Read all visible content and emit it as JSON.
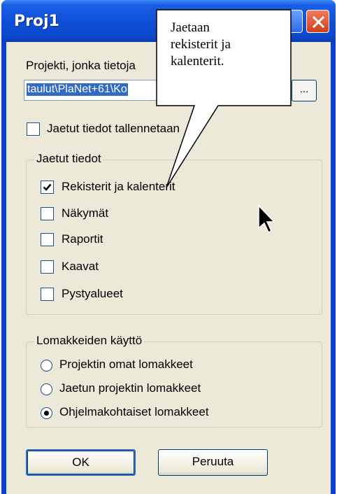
{
  "window": {
    "title": "Proj1"
  },
  "project": {
    "label": "Projekti, jonka tietoja",
    "path_value": "taulut\\PlaNet+61\\Ko",
    "browse_label": "..."
  },
  "save_shared": {
    "label": "Jaetut tiedot tallennetaan",
    "checked": false
  },
  "shared_group": {
    "legend": "Jaetut tiedot",
    "items": [
      {
        "label": "Rekisterit ja kalenterit",
        "checked": true
      },
      {
        "label": "Näkymät",
        "checked": false
      },
      {
        "label": "Raportit",
        "checked": false
      },
      {
        "label": "Kaavat",
        "checked": false
      },
      {
        "label": "Pystyalueet",
        "checked": false
      }
    ]
  },
  "forms_group": {
    "legend": "Lomakkeiden käyttö",
    "options": [
      {
        "label": "Projektin omat lomakkeet",
        "selected": false
      },
      {
        "label": "Jaetun projektin lomakkeet",
        "selected": false
      },
      {
        "label": "Ohjelmakohtaiset lomakkeet",
        "selected": true
      }
    ]
  },
  "buttons": {
    "ok": "OK",
    "cancel": "Peruuta"
  },
  "callout": {
    "line1": "Jaetaan",
    "line2": "rekisterit ja",
    "line3": "kalenterit."
  },
  "colors": {
    "titlebar": "#0c47cc",
    "dialog_bg": "#ece9d8",
    "selection": "#316ac5",
    "close_button": "#d2401e"
  }
}
